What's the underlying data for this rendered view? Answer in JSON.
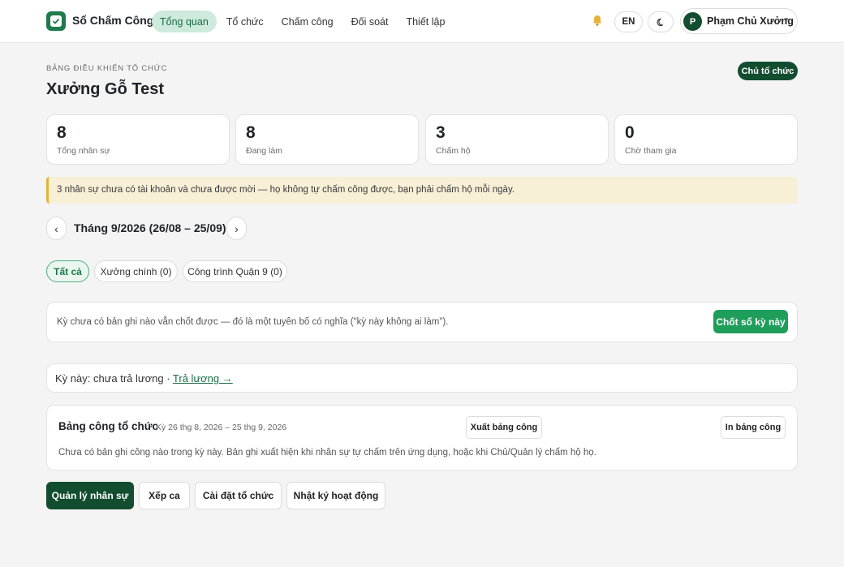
{
  "app": {
    "brand": "Sổ Chấm Công"
  },
  "nav": [
    {
      "label": "Tổng quan",
      "active": true
    },
    {
      "label": "Tổ chức",
      "active": false
    },
    {
      "label": "Chấm công",
      "active": false
    },
    {
      "label": "Đối soát",
      "active": false
    },
    {
      "label": "Thiết lập",
      "active": false
    }
  ],
  "header": {
    "lang": "EN",
    "user_initial": "P",
    "user_name": "Phạm Chủ Xưởng"
  },
  "page": {
    "eyebrow": "BẢNG ĐIỀU KHIỂN TỔ CHỨC",
    "title": "Xưởng Gỗ Test",
    "role_badge": "Chủ tổ chức"
  },
  "stats": [
    {
      "value": "8",
      "label": "Tổng nhân sự"
    },
    {
      "value": "8",
      "label": "Đang làm"
    },
    {
      "value": "3",
      "label": "Chấm hộ"
    },
    {
      "value": "0",
      "label": "Chờ tham gia"
    }
  ],
  "alert": "3 nhân sự chưa có tài khoản và chưa được mời — họ không tự chấm công được, bạn phải chấm hộ mỗi ngày.",
  "period": {
    "prev": "‹",
    "label": "Tháng 9/2026 (26/08 – 25/09)",
    "next": "›"
  },
  "filters": [
    {
      "label": "Tất cả",
      "active": true
    },
    {
      "label": "Xưởng chính (0)",
      "active": false
    },
    {
      "label": "Công trình Quận 9 (0)",
      "active": false
    }
  ],
  "close_panel": {
    "text": "Kỳ chưa có bản ghi nào vẫn chốt được — đó là một tuyên bố có nghĩa (\"kỳ này không ai làm\").",
    "button": "Chốt sổ kỳ này"
  },
  "payroll": {
    "text": "Kỳ này: chưa trả lương · ",
    "link": "Trả lương →"
  },
  "timesheet": {
    "title": "Bảng công tổ chức",
    "range": "Kỳ 26 thg 8, 2026 – 25 thg 9, 2026",
    "export": "Xuất bảng công",
    "print": "In bảng công",
    "empty": "Chưa có bản ghi công nào trong kỳ này. Bản ghi xuất hiện khi nhân sự tự chấm trên ứng dụng, hoặc khi Chủ/Quản lý chấm hộ họ."
  },
  "actions": [
    {
      "label": "Quản lý nhân sự",
      "primary": true
    },
    {
      "label": "Xếp ca",
      "primary": false
    },
    {
      "label": "Cài đặt tổ chức",
      "primary": false
    },
    {
      "label": "Nhật ký hoạt động",
      "primary": false
    }
  ],
  "colors": {
    "brand": "#1f7a4c",
    "dark_green": "#124d30",
    "accent": "#1f9d5b",
    "alert_bg": "#f7efd6"
  }
}
